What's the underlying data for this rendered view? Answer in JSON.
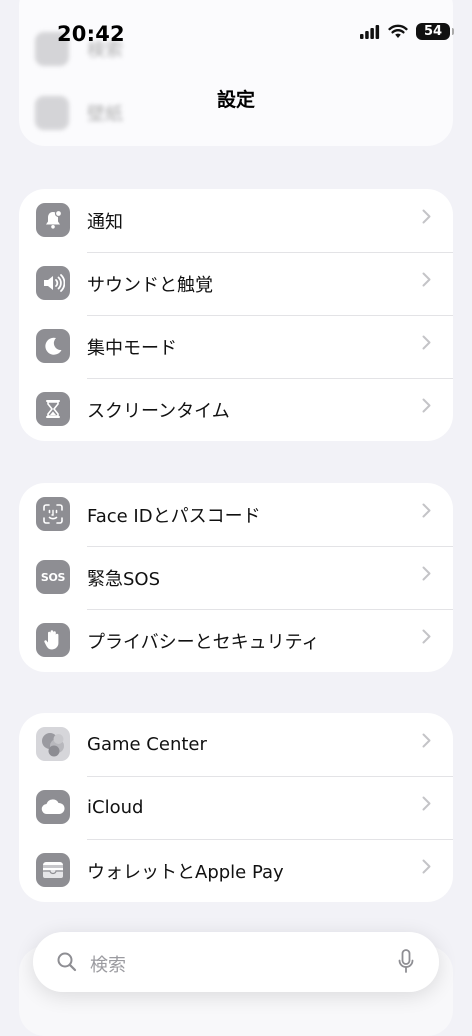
{
  "status_bar": {
    "time": "20:42",
    "battery": "54"
  },
  "header": {
    "title": "設定",
    "faded_rows": [
      "検索",
      "壁紙"
    ]
  },
  "groups": [
    {
      "items": [
        {
          "label": "通知",
          "icon": "bell-icon"
        },
        {
          "label": "サウンドと触覚",
          "icon": "speaker-icon"
        },
        {
          "label": "集中モード",
          "icon": "moon-icon"
        },
        {
          "label": "スクリーンタイム",
          "icon": "hourglass-icon"
        }
      ]
    },
    {
      "items": [
        {
          "label": "Face IDとパスコード",
          "icon": "face-id-icon"
        },
        {
          "label": "緊急SOS",
          "icon": "sos-icon",
          "icon_text": "SOS"
        },
        {
          "label": "プライバシーとセキュリティ",
          "icon": "hand-icon"
        }
      ]
    },
    {
      "items": [
        {
          "label": "Game Center",
          "icon": "game-center-icon"
        },
        {
          "label": "iCloud",
          "icon": "cloud-icon"
        },
        {
          "label": "ウォレットとApple Pay",
          "icon": "wallet-icon"
        }
      ]
    }
  ],
  "search": {
    "placeholder": "検索"
  },
  "colors": {
    "icon_gray": "#8e8e93",
    "background": "#f2f2f7",
    "card": "#ffffff",
    "chevron": "#c4c4c7"
  }
}
